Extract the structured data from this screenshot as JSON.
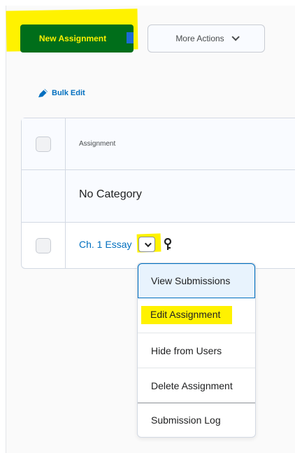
{
  "toolbar": {
    "new_assignment": "New Assignment",
    "more_actions": "More Actions"
  },
  "bulk_edit": {
    "label": "Bulk Edit"
  },
  "table": {
    "column_header": "Assignment",
    "category": "No Category",
    "rows": [
      {
        "title": "Ch. 1 Essay"
      }
    ]
  },
  "context_menu": {
    "items": [
      "View Submissions",
      "Edit Assignment",
      "Hide from Users",
      "Delete Assignment",
      "Submission Log"
    ]
  },
  "icons": {
    "bulk_edit": "pencil-icon",
    "dropdown": "chevron-down-icon",
    "key": "key-icon"
  },
  "colors": {
    "primary_button": "#006e1a",
    "primary_text": "#fff200",
    "link": "#006fbf",
    "highlight": "#fff200",
    "menu_hover": "#e8f3fd"
  }
}
